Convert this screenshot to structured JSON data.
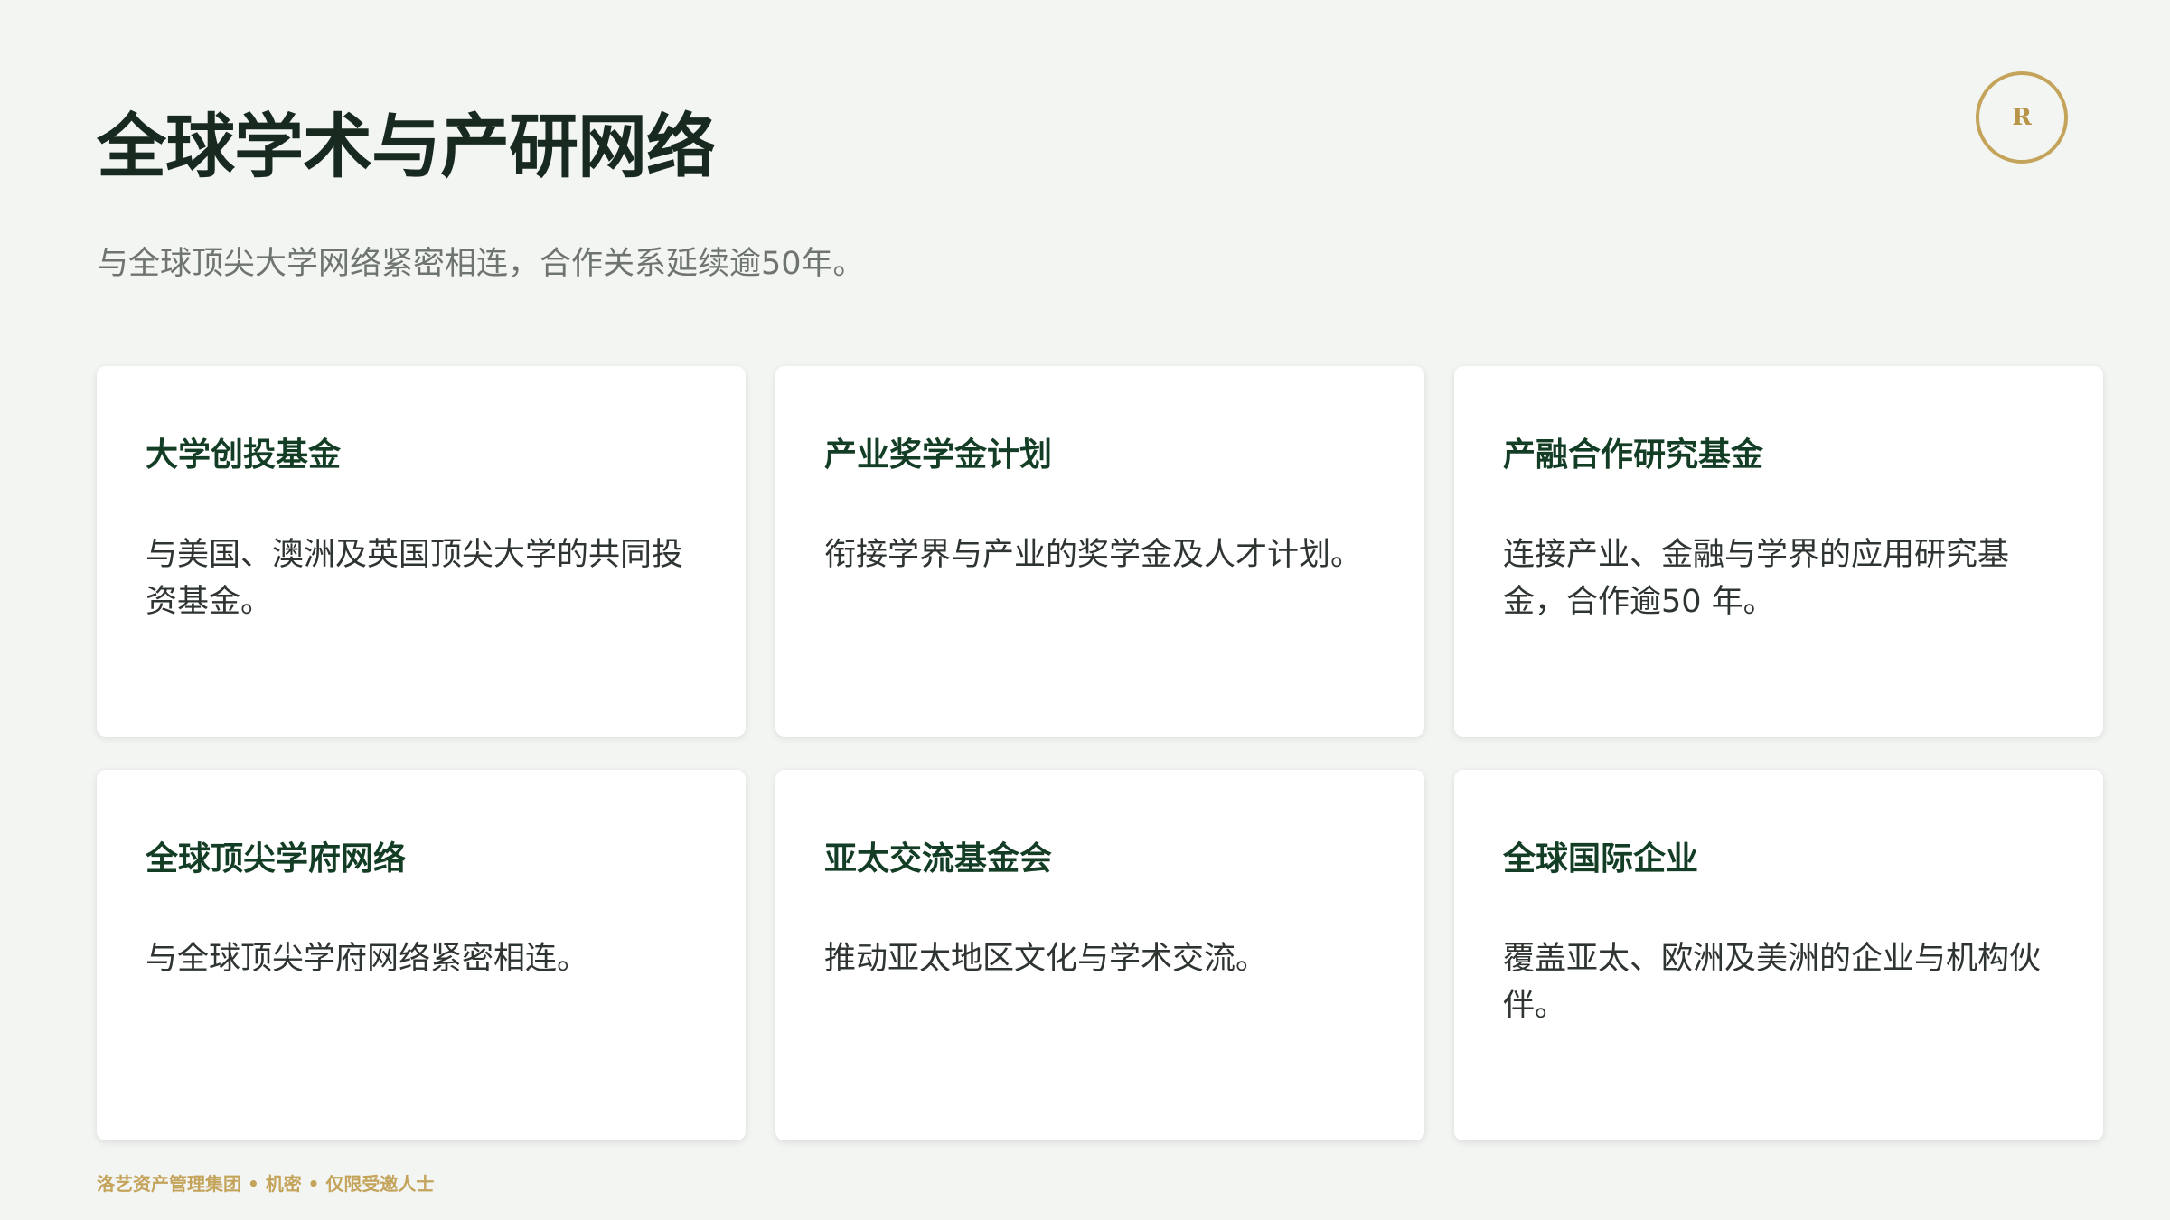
{
  "header": {
    "title": "全球学术与产研网络",
    "subtitle": "与全球顶尖大学网络紧密相连，合作关系延续逾50年。",
    "logo_letter": "R"
  },
  "cards": [
    {
      "title": "大学创投基金",
      "description": "与美国、澳洲及英国顶尖大学的共同投资基金。"
    },
    {
      "title": "产业奖学金计划",
      "description": "衔接学界与产业的奖学金及人才计划。"
    },
    {
      "title": "产融合作研究基金",
      "description": "连接产业、金融与学界的应用研究基金，合作逾50 年。"
    },
    {
      "title": "全球顶尖学府网络",
      "description": "与全球顶尖学府网络紧密相连。"
    },
    {
      "title": "亚太交流基金会",
      "description": "推动亚太地区文化与学术交流。"
    },
    {
      "title": "全球国际企业",
      "description": "覆盖亚太、欧洲及美洲的企业与机构伙伴。"
    }
  ],
  "footer": {
    "text": "洛艺资产管理集团 • 机密 • 仅限受邀人士"
  },
  "colors": {
    "background": "#f3f5f3",
    "title": "#182a20",
    "card_title": "#133d25",
    "accent_gold": "#c4a35b"
  }
}
